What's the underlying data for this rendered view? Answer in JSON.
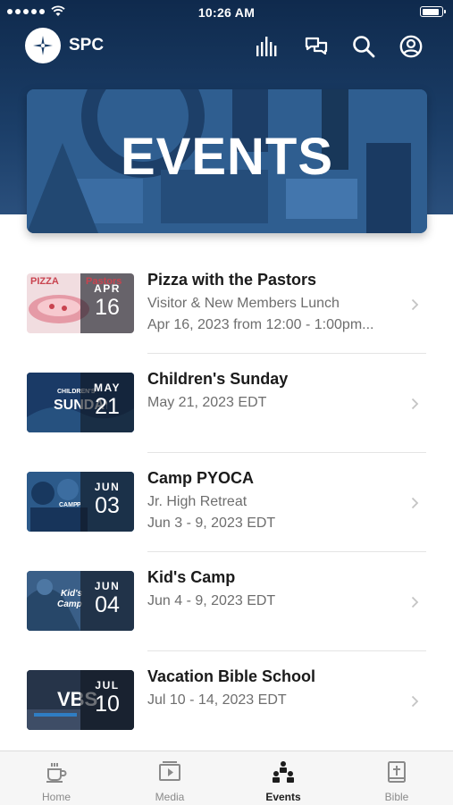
{
  "status": {
    "time": "10:26 AM",
    "battery_level": 0.9
  },
  "header": {
    "brand": "SPC",
    "icons": [
      "stats-icon",
      "chat-icon",
      "search-icon",
      "profile-icon"
    ]
  },
  "banner": {
    "title": "EVENTS"
  },
  "events": [
    {
      "title": "Pizza with the Pastors",
      "subtitle": "Visitor & New Members Lunch",
      "detail": "Apr 16, 2023 from 12:00 - 1:00pm...",
      "month": "APR",
      "day": "16",
      "thumb_text": "PIZZA",
      "thumb_text2": "Pastors"
    },
    {
      "title": "Children's Sunday",
      "subtitle": "May 21, 2023 EDT",
      "detail": "",
      "month": "MAY",
      "day": "21",
      "thumb_text": "CHILDREN'S",
      "thumb_text2": "SUNDAY"
    },
    {
      "title": "Camp PYOCA",
      "subtitle": "Jr. High Retreat",
      "detail": "Jun 3 - 9, 2023 EDT",
      "month": "JUN",
      "day": "03",
      "thumb_text": "CAMP",
      "thumb_text2": "PYOCA"
    },
    {
      "title": "Kid's Camp",
      "subtitle": "Jun 4 - 9, 2023 EDT",
      "detail": "",
      "month": "JUN",
      "day": "04",
      "thumb_text": "Kid's",
      "thumb_text2": "Camp"
    },
    {
      "title": "Vacation Bible School",
      "subtitle": "Jul 10 - 14, 2023 EDT",
      "detail": "",
      "month": "JUL",
      "day": "10",
      "thumb_text": "VBS",
      "thumb_text2": ""
    }
  ],
  "tabs": [
    {
      "label": "Home",
      "icon": "coffee-cup-icon"
    },
    {
      "label": "Media",
      "icon": "video-player-icon"
    },
    {
      "label": "Events",
      "icon": "events-people-icon",
      "active": true
    },
    {
      "label": "Bible",
      "icon": "bible-icon"
    }
  ],
  "colors": {
    "header_bg": "#1b3e68",
    "accent": "#1d1d1d",
    "inactive_tab": "#8a8a8a"
  }
}
